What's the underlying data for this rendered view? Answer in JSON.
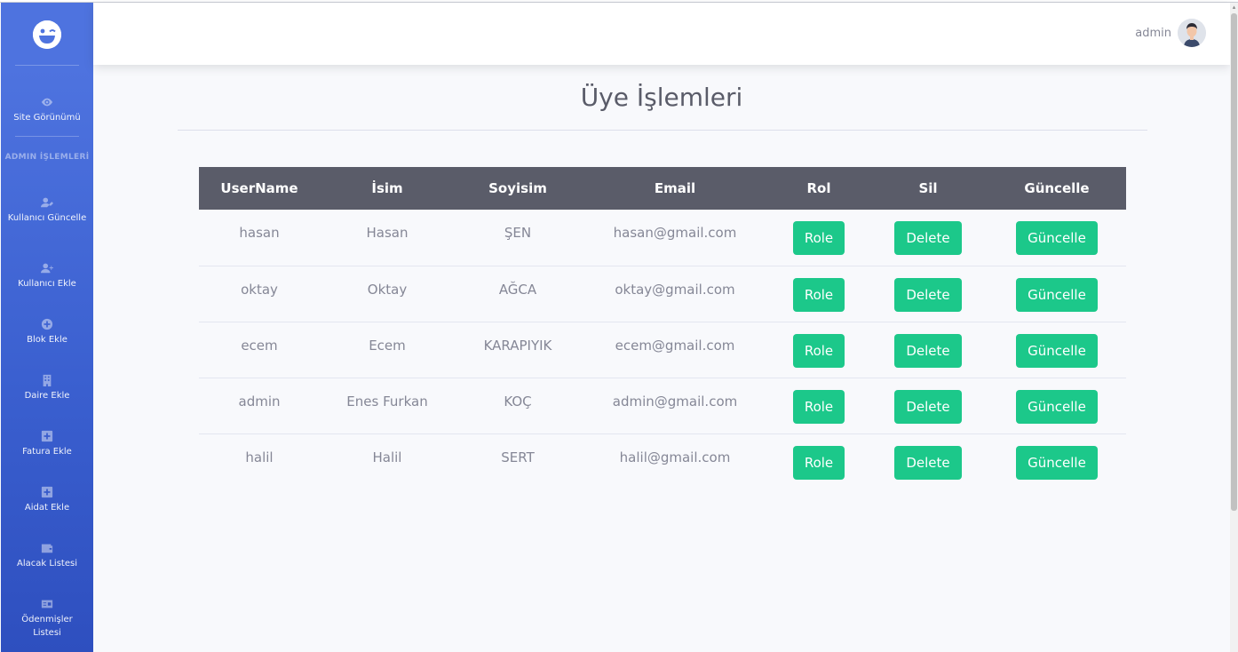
{
  "sidebar": {
    "heading": "ADMIN İŞLEMLERİ",
    "items": [
      {
        "label": "Site Görünümü",
        "icon": "eye-icon"
      },
      {
        "label": "Kullanıcı Güncelle",
        "icon": "user-edit-icon"
      },
      {
        "label": "Kullanıcı Ekle",
        "icon": "user-plus-icon"
      },
      {
        "label": "Blok Ekle",
        "icon": "plus-circle-icon"
      },
      {
        "label": "Daire Ekle",
        "icon": "building-icon"
      },
      {
        "label": "Fatura Ekle",
        "icon": "plus-square-icon"
      },
      {
        "label": "Aidat Ekle",
        "icon": "plus-square-icon"
      },
      {
        "label": "Alacak Listesi",
        "icon": "wallet-icon"
      },
      {
        "label": "Ödenmişler Listesi",
        "icon": "money-bill-icon"
      }
    ]
  },
  "topbar": {
    "user_name": "admin"
  },
  "page": {
    "title": "Üye İşlemleri"
  },
  "table": {
    "headers": [
      "UserName",
      "İsim",
      "Soyisim",
      "Email",
      "Rol",
      "Sil",
      "Güncelle"
    ],
    "rows": [
      {
        "username": "hasan",
        "isim": "Hasan",
        "soyisim": "ŞEN",
        "email": "hasan@gmail.com",
        "role_label": "Role",
        "delete_label": "Delete",
        "update_label": "Güncelle"
      },
      {
        "username": "oktay",
        "isim": "Oktay",
        "soyisim": "AĞCA",
        "email": "oktay@gmail.com",
        "role_label": "Role",
        "delete_label": "Delete",
        "update_label": "Güncelle"
      },
      {
        "username": "ecem",
        "isim": "Ecem",
        "soyisim": "KARAPIYIK",
        "email": "ecem@gmail.com",
        "role_label": "Role",
        "delete_label": "Delete",
        "update_label": "Güncelle"
      },
      {
        "username": "admin",
        "isim": "Enes Furkan",
        "soyisim": "KOÇ",
        "email": "admin@gmail.com",
        "role_label": "Role",
        "delete_label": "Delete",
        "update_label": "Güncelle"
      },
      {
        "username": "halil",
        "isim": "Halil",
        "soyisim": "SERT",
        "email": "halil@gmail.com",
        "role_label": "Role",
        "delete_label": "Delete",
        "update_label": "Güncelle"
      }
    ]
  },
  "colors": {
    "sidebar": "#4e73df",
    "header_row": "#5a5c69",
    "button": "#1cc88a"
  }
}
